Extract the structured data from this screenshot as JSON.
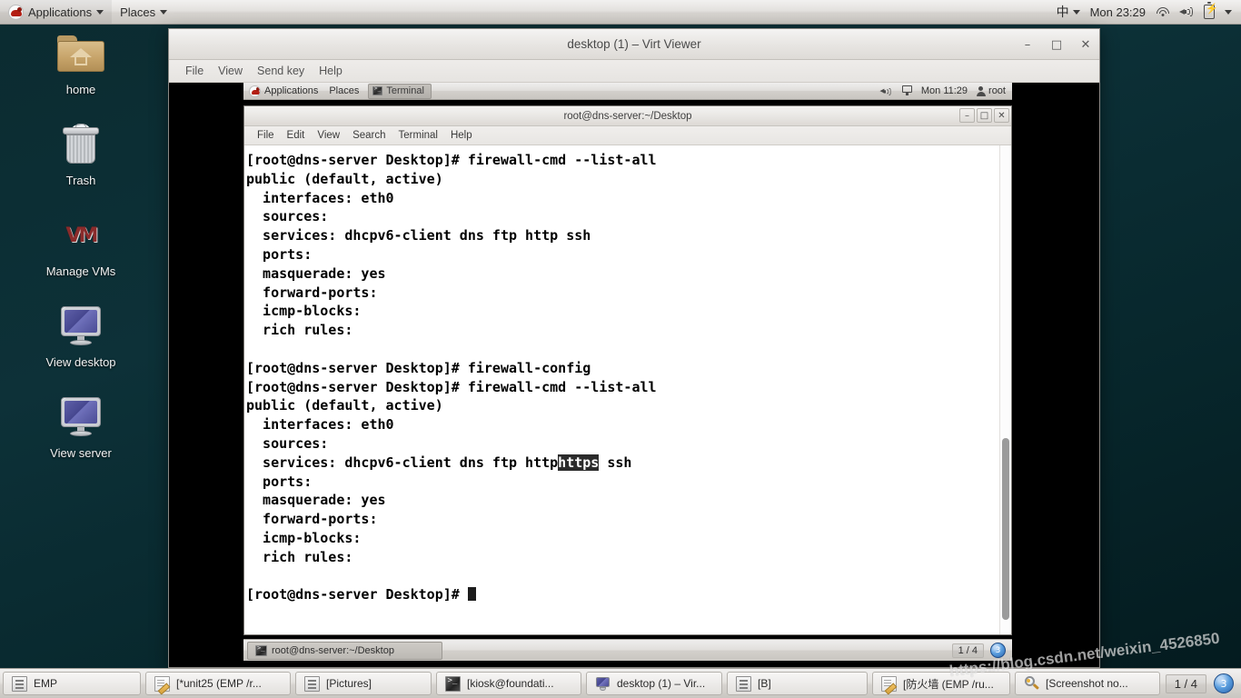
{
  "host": {
    "top_panel": {
      "applications_label": "Applications",
      "places_label": "Places",
      "ime_label": "中",
      "clock": "Mon 23:29",
      "icons": [
        "redhat-logo",
        "wifi-icon",
        "volume-icon",
        "battery-icon",
        "chevron-down-icon"
      ]
    },
    "desktop_icons": [
      {
        "label": "home",
        "icon": "home-folder-icon"
      },
      {
        "label": "Trash",
        "icon": "trash-icon"
      },
      {
        "label": "Manage VMs",
        "icon": "vmm-icon",
        "glyph": "VM"
      },
      {
        "label": "View desktop",
        "icon": "monitor-icon"
      },
      {
        "label": "View server",
        "icon": "monitor-icon"
      }
    ],
    "taskbar": {
      "buttons": [
        {
          "label": "EMP",
          "icon": "archive-icon",
          "width": "w1"
        },
        {
          "label": "[*unit25 (EMP /r...",
          "icon": "note-icon",
          "width": "w2"
        },
        {
          "label": "[Pictures]",
          "icon": "archive-icon",
          "width": "w3"
        },
        {
          "label": "[kiosk@foundati...",
          "icon": "terminal-icon",
          "width": "w4"
        },
        {
          "label": "desktop (1) – Vir...",
          "icon": "monitor-icon",
          "width": "w5"
        },
        {
          "label": "[B]",
          "icon": "archive-icon",
          "width": "w6"
        },
        {
          "label": "[防火墙 (EMP /ru...",
          "icon": "note-icon",
          "width": "w7"
        },
        {
          "label": "[Screenshot no...",
          "icon": "magnifier-icon",
          "width": "w8"
        }
      ],
      "workspace": "1 / 4",
      "orb_label": "3"
    }
  },
  "virt_viewer": {
    "title": "desktop (1) – Virt Viewer",
    "window_controls": {
      "minimize": "–",
      "maximize": "□",
      "close": "✕"
    },
    "menu": [
      "File",
      "View",
      "Send key",
      "Help"
    ]
  },
  "guest": {
    "top_panel": {
      "applications_label": "Applications",
      "places_label": "Places",
      "active_task": "Terminal",
      "clock": "Mon 11:29",
      "user": "root",
      "icons": [
        "redhat-logo",
        "volume-icon",
        "network-icon",
        "user-icon"
      ]
    },
    "terminal": {
      "title": "root@dns-server:~/Desktop",
      "window_controls": {
        "minimize": "–",
        "maximize": "□",
        "close": "✕"
      },
      "menu": [
        "File",
        "Edit",
        "View",
        "Search",
        "Terminal",
        "Help"
      ],
      "lines": [
        {
          "text": "[root@dns-server Desktop]# firewall-cmd --list-all"
        },
        {
          "text": "public (default, active)"
        },
        {
          "text": "  interfaces: eth0"
        },
        {
          "text": "  sources:"
        },
        {
          "text": "  services: dhcpv6-client dns ftp http ssh"
        },
        {
          "text": "  ports:"
        },
        {
          "text": "  masquerade: yes"
        },
        {
          "text": "  forward-ports:"
        },
        {
          "text": "  icmp-blocks:"
        },
        {
          "text": "  rich rules:"
        },
        {
          "text": ""
        },
        {
          "text": "[root@dns-server Desktop]# firewall-config"
        },
        {
          "text": "[root@dns-server Desktop]# firewall-cmd --list-all"
        },
        {
          "text": "public (default, active)"
        },
        {
          "text": "  interfaces: eth0"
        },
        {
          "text": "  sources:"
        },
        {
          "text": "  services: dhcpv6-client dns ftp http",
          "highlight": "https",
          "after": " ssh"
        },
        {
          "text": "  ports:"
        },
        {
          "text": "  masquerade: yes"
        },
        {
          "text": "  forward-ports:"
        },
        {
          "text": "  icmp-blocks:"
        },
        {
          "text": "  rich rules:"
        },
        {
          "text": ""
        },
        {
          "text": "[root@dns-server Desktop]# ",
          "cursor": true
        }
      ]
    },
    "bottom_panel": {
      "window_button": "root@dns-server:~/Desktop",
      "workspace": "1 / 4",
      "orb_label": "3"
    }
  },
  "watermark": "https://blog.csdn.net/weixin_4526850"
}
